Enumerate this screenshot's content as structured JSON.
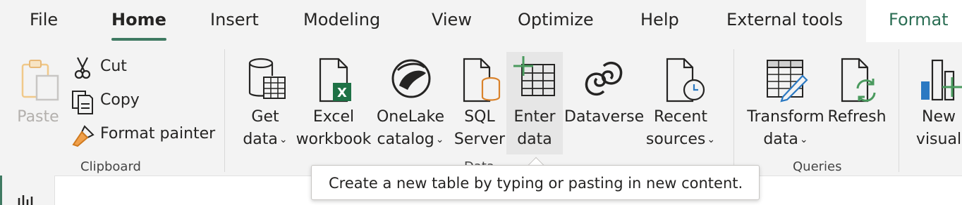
{
  "tabs": [
    {
      "label": "File"
    },
    {
      "label": "Home"
    },
    {
      "label": "Insert"
    },
    {
      "label": "Modeling"
    },
    {
      "label": "View"
    },
    {
      "label": "Optimize"
    },
    {
      "label": "Help"
    },
    {
      "label": "External tools"
    },
    {
      "label": "Format"
    }
  ],
  "active_tab": "Home",
  "clipboard": {
    "paste": "Paste",
    "cut": "Cut",
    "copy": "Copy",
    "format_painter": "Format painter",
    "group_label": "Clipboard"
  },
  "data": {
    "get_data": {
      "line1": "Get",
      "line2": "data"
    },
    "excel": {
      "line1": "Excel",
      "line2": "workbook"
    },
    "onelake": {
      "line1": "OneLake",
      "line2": "catalog"
    },
    "sql": {
      "line1": "SQL",
      "line2": "Server"
    },
    "enter": {
      "line1": "Enter",
      "line2": "data"
    },
    "dataverse": {
      "line1": "Dataverse"
    },
    "recent": {
      "line1": "Recent",
      "line2": "sources"
    },
    "group_label": "Data"
  },
  "queries": {
    "transform": {
      "line1": "Transform",
      "line2": "data"
    },
    "refresh": {
      "line1": "Refresh"
    },
    "group_label": "Queries"
  },
  "insert": {
    "new_visual": {
      "line1": "New",
      "line2": "visual"
    }
  },
  "tooltip": "Create a new table by typing or pasting in new content.",
  "colors": {
    "accent": "#3f7a62",
    "format_tab": "#2b6e54",
    "excel_green": "#1e7145",
    "sql_orange": "#d9822b",
    "clock_blue": "#2b79c2"
  }
}
